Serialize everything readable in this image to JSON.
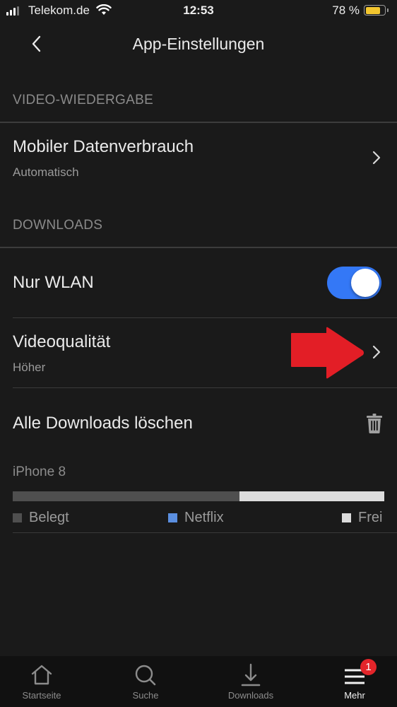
{
  "status_bar": {
    "carrier": "Telekom.de",
    "time": "12:53",
    "battery_percent_text": "78 %",
    "battery_level": 0.78,
    "signal_bars": 3,
    "signal_bars_max": 4,
    "battery_color": "#f3c62f"
  },
  "navbar": {
    "title": "App-Einstellungen",
    "back_icon": "chevron-left-icon"
  },
  "sections": {
    "video": {
      "header": "VIDEO-WIEDERGABE",
      "items": [
        {
          "title": "Mobiler Datenverbrauch",
          "subtitle": "Automatisch",
          "icon": "chevron-right-icon"
        }
      ]
    },
    "downloads": {
      "header": "DOWNLOADS",
      "wifi_only": {
        "title": "Nur WLAN",
        "enabled": true,
        "toggle_color": "#3478f6"
      },
      "video_quality": {
        "title": "Videoqualität",
        "subtitle": "Höher",
        "icon": "chevron-right-icon"
      },
      "delete_all": {
        "title": "Alle Downloads löschen",
        "icon": "trash-icon"
      }
    }
  },
  "storage": {
    "device": "iPhone 8",
    "used_fraction": 0.61,
    "netflix_fraction": 0.0,
    "free_fraction": 0.39,
    "legend": [
      {
        "label": "Belegt",
        "color": "#4f4f4f"
      },
      {
        "label": "Netflix",
        "color": "#5b8fe0"
      },
      {
        "label": "Frei",
        "color": "#dcdcdc"
      }
    ]
  },
  "annotation": {
    "arrow_icon": "red-arrow-icon",
    "color": "#e31e26"
  },
  "tabbar": {
    "tabs": [
      {
        "label": "Startseite",
        "icon": "home-icon",
        "active": false
      },
      {
        "label": "Suche",
        "icon": "search-icon",
        "active": false
      },
      {
        "label": "Downloads",
        "icon": "download-icon",
        "active": false
      },
      {
        "label": "Mehr",
        "icon": "menu-icon",
        "active": true
      }
    ],
    "badge_count": "1",
    "badge_color": "#e3252a"
  }
}
